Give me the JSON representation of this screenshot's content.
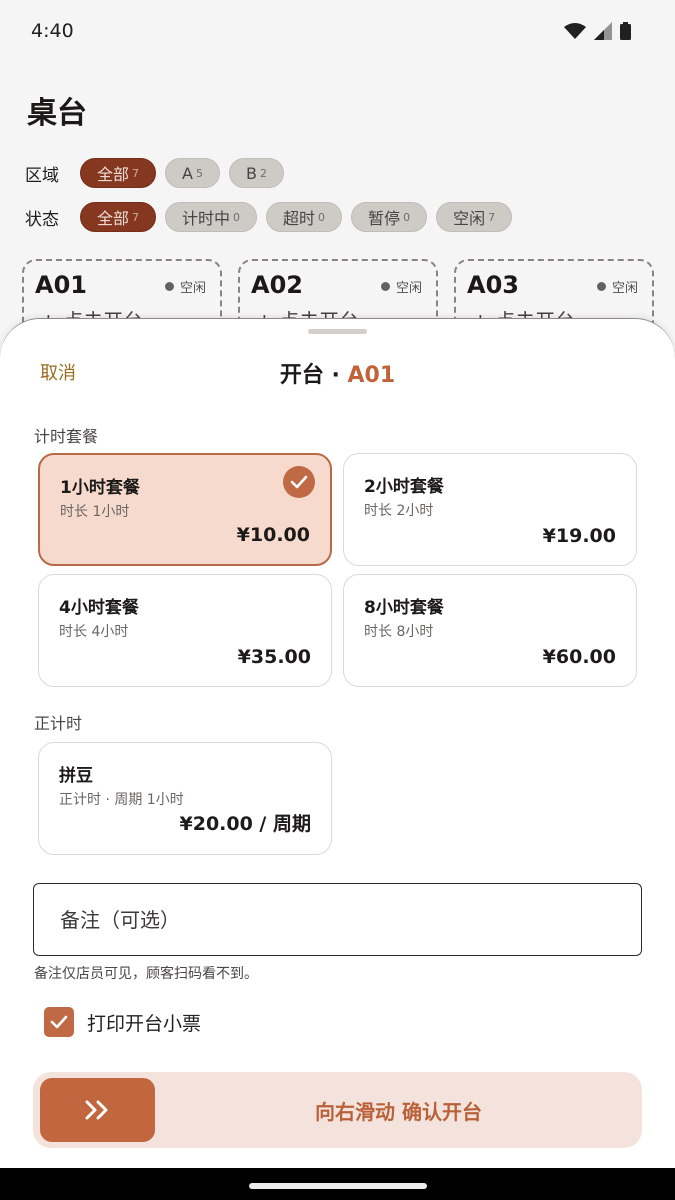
{
  "status_bar": {
    "time": "4:40"
  },
  "page": {
    "title": "桌台",
    "area_filter": {
      "label": "区域",
      "chips": [
        {
          "label": "全部",
          "count": "7",
          "active": true
        },
        {
          "label": "A",
          "count": "5",
          "active": false
        },
        {
          "label": "B",
          "count": "2",
          "active": false
        }
      ]
    },
    "status_filter": {
      "label": "状态",
      "chips": [
        {
          "label": "全部",
          "count": "7",
          "active": true
        },
        {
          "label": "计时中",
          "count": "0",
          "active": false
        },
        {
          "label": "超时",
          "count": "0",
          "active": false
        },
        {
          "label": "暂停",
          "count": "0",
          "active": false
        },
        {
          "label": "空闲",
          "count": "7",
          "active": false
        }
      ]
    },
    "tables": [
      {
        "name": "A01",
        "status": "空闲",
        "action": "+ 点击开台"
      },
      {
        "name": "A02",
        "status": "空闲",
        "action": "+ 点击开台"
      },
      {
        "name": "A03",
        "status": "空闲",
        "action": "+ 点击开台"
      }
    ]
  },
  "sheet": {
    "cancel_label": "取消",
    "title_prefix": "开台 · ",
    "table_id": "A01",
    "timed_section_label": "计时套餐",
    "packages": [
      {
        "name": "1小时套餐",
        "desc": "时长 1小时",
        "price": "¥10.00",
        "selected": true
      },
      {
        "name": "2小时套餐",
        "desc": "时长 2小时",
        "price": "¥19.00",
        "selected": false
      },
      {
        "name": "4小时套餐",
        "desc": "时长 4小时",
        "price": "¥35.00",
        "selected": false
      },
      {
        "name": "8小时套餐",
        "desc": "时长 8小时",
        "price": "¥60.00",
        "selected": false
      }
    ],
    "count_up_section_label": "正计时",
    "count_up_packages": [
      {
        "name": "拼豆",
        "desc": "正计时 · 周期 1小时",
        "price": "¥20.00 / 周期",
        "selected": false
      }
    ],
    "note": {
      "placeholder": "备注（可选）",
      "value": "",
      "hint": "备注仅店员可见，顾客扫码看不到。"
    },
    "print_ticket": {
      "label": "打印开台小票",
      "checked": true
    },
    "slider": {
      "label": "向右滑动 确认开台",
      "icon": "double-chevron-right-icon"
    },
    "colors": {
      "accent": "#c2663f",
      "selected_bg": "#f5dacd",
      "chip_active": "#8b3a22",
      "cancel": "#9a6d23"
    }
  }
}
